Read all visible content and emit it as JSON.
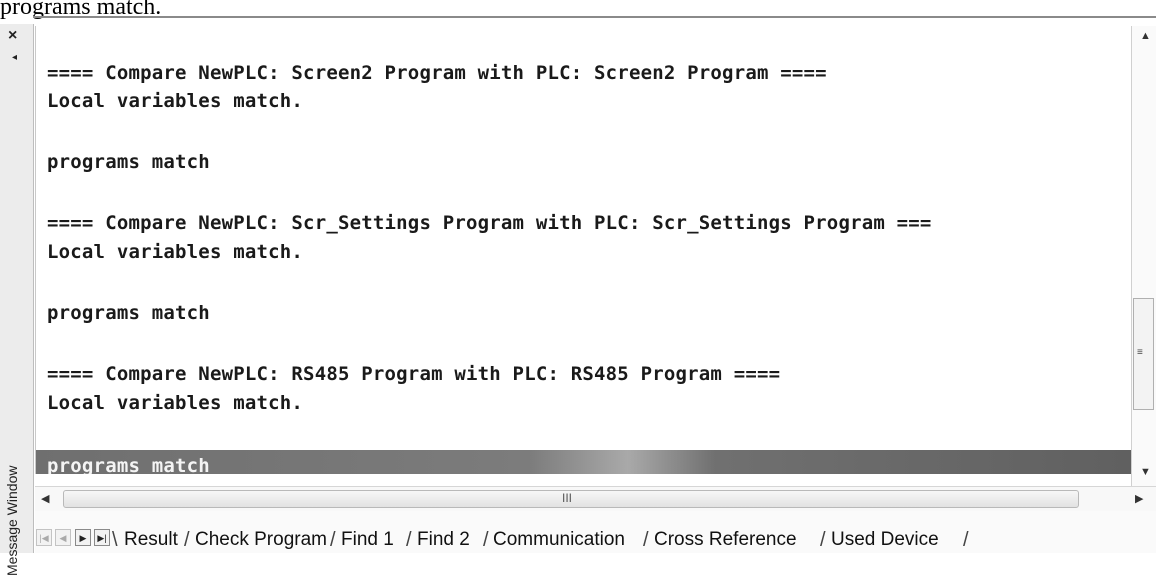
{
  "caption": "programs match.",
  "window": {
    "title_vertical": "Message Window",
    "close_glyph": "×",
    "pin_glyph": "◂"
  },
  "output": {
    "lines": [
      "==== Compare NewPLC: Screen2 Program with PLC: Screen2 Program ====",
      "Local variables match.",
      "programs match",
      "==== Compare NewPLC: Scr_Settings Program with PLC: Scr_Settings Program ===",
      "Local variables match.",
      "programs match",
      "==== Compare NewPLC: RS485 Program with PLC: RS485 Program ====",
      "Local variables match.",
      "programs match"
    ],
    "selected_line_index": 8
  },
  "scrollbars": {
    "up": "▲",
    "down": "▼",
    "left": "◀",
    "right": "▶",
    "grip_v": "≡",
    "grip_h": "III"
  },
  "tabs": {
    "nav": [
      "|◀",
      "◀",
      "▶",
      "▶|"
    ],
    "items": [
      "Result",
      "Check Program",
      "Find 1",
      "Find 2",
      "Communication",
      "Cross Reference",
      "Used Device"
    ],
    "active_index": 0
  }
}
